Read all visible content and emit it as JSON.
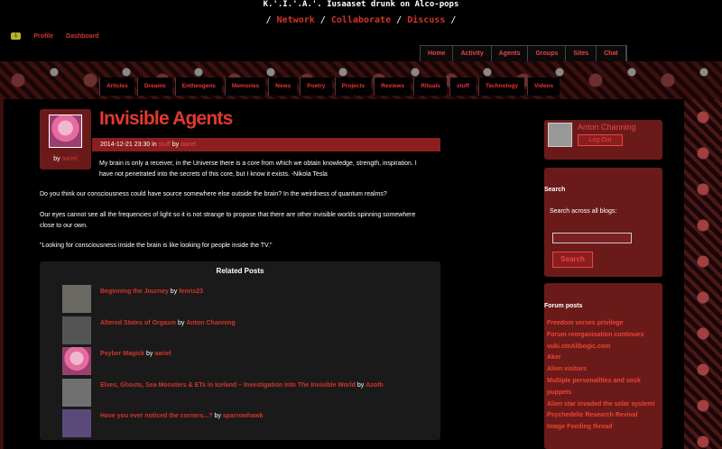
{
  "site": {
    "title": "K.'.I.'.A.'. Iusaaset drunk on Alco-pops",
    "links": [
      "Network",
      "Collaborate",
      "Discuss"
    ],
    "sep": "/"
  },
  "userbar": {
    "notifications": "1",
    "profile": "Profile",
    "dashboard": "Dashboard"
  },
  "topnav": [
    "Home",
    "Activity",
    "Agents",
    "Groups",
    "Sites",
    "Chat"
  ],
  "catnav": [
    "Articles",
    "Dreams",
    "Entheogens",
    "Memories",
    "News",
    "Poetry",
    "Projects",
    "Reviews",
    "Rituals",
    "stuff",
    "Technology",
    "Videos"
  ],
  "post": {
    "title": "Invisible Agents",
    "date": "2014-12-21 23:30",
    "in_label": "in",
    "category": "stuff",
    "by_label": "by",
    "author": "aariel",
    "quote": "My brain is only a receiver, in the Universe there is a core from which we obtain knowledge, strength, inspiration. I have not penetrated into the secrets of this core, but I know it exists. -Nikola Tesla",
    "p1": "Do you think our consciousness could have source somewhere else outside the brain? In the weirdness of quantum realms?",
    "p2": "Our eyes cannot see all the frequencies of light so it is not strange to propose that there are other invisible worlds spinning somewhere close to our own.",
    "p3": "\"Looking for consciousness inside the brain is like looking for people inside the TV.\""
  },
  "author_box": {
    "by": "by",
    "name": "aariel"
  },
  "related": {
    "title": "Related Posts",
    "items": [
      {
        "title": "Beginning the Journey",
        "by": "by",
        "author": "fenris23"
      },
      {
        "title": "Altered States of Orgasm",
        "by": "by",
        "author": "Anton Channing"
      },
      {
        "title": "Psyber Magick",
        "by": "by",
        "author": "aariel"
      },
      {
        "title": "Elves, Ghosts, Sea Monsters & ETs in Iceland – Investigation Into The Invisible World",
        "by": "by",
        "author": "Azoth"
      },
      {
        "title": "Have you ever noticed the corners...?",
        "by": "by",
        "author": "sparrowhawk"
      }
    ]
  },
  "sidebar": {
    "profile_name": "Anton Channing",
    "profile_button": "Log Out",
    "search_title": "Search",
    "search_desc": "Search across all blogs:",
    "search_button": "Search",
    "forum_title": "Forum posts",
    "forum_items": [
      "Freedom verses privilege",
      "Forum reorganisation continues",
      "vuki.stoAlibogic.com",
      "Aker",
      "Alien visitors",
      "Multiple personalities and sock puppets",
      "Alien star invaded the solar system!",
      "Psychedelic Research Revival",
      "Image Feeding thread"
    ]
  },
  "colors": {
    "accent": "#d4342a",
    "panel": "#6b1a1a",
    "meta": "#8b1e1e"
  }
}
